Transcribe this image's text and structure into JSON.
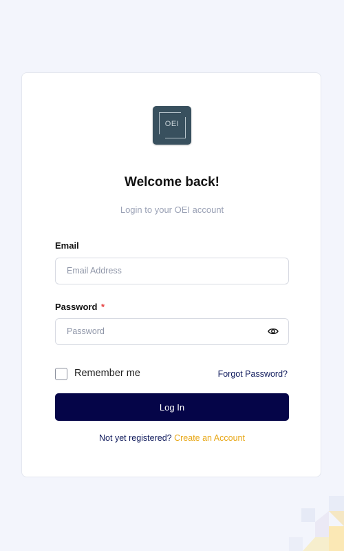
{
  "brand": {
    "logo_text": "OEI"
  },
  "login": {
    "title": "Welcome back!",
    "subtitle": "Login to your OEI account",
    "email_label": "Email",
    "email_placeholder": "Email Address",
    "email_value": "",
    "password_label": "Password",
    "password_required_marker": "*",
    "password_placeholder": "Password",
    "password_value": "",
    "remember_label": "Remember me",
    "remember_checked": false,
    "forgot_label": "Forgot Password?",
    "login_button": "Log In",
    "register_prompt": "Not yet registered?",
    "register_link": "Create an Account"
  },
  "colors": {
    "primary": "#050548",
    "accent": "#e8a613",
    "required": "#e53e3e",
    "logo_bg": "#38505e",
    "background": "#f3f5fc"
  },
  "icons": {
    "password_toggle": "eye-icon"
  }
}
